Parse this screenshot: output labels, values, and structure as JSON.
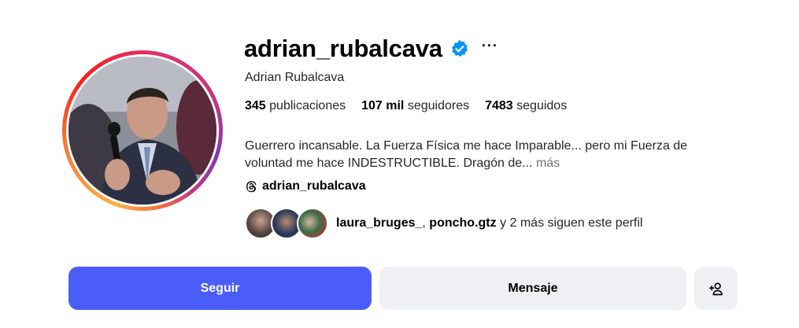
{
  "profile": {
    "username": "adrian_rubalcava",
    "full_name": "Adrian Rubalcava",
    "stats": {
      "posts_count": "345",
      "posts_label": "publicaciones",
      "followers_count": "107 mil",
      "followers_label": "seguidores",
      "following_count": "7483",
      "following_label": "seguidos"
    },
    "bio": "Guerrero incansable. La Fuerza Física me hace Imparable... pero mi Fuerza de voluntad me hace INDESTRUCTIBLE. Dragón de...",
    "bio_more": "más",
    "threads_handle": "adrian_rubalcava",
    "followed_by": {
      "user1": "laura_bruges_",
      "separator": ",",
      "user2": "poncho.gtz",
      "suffix": "y 2 más siguen este perfil"
    }
  },
  "actions": {
    "follow_label": "Seguir",
    "message_label": "Mensaje"
  },
  "icons": {
    "verified": "verified-badge-icon",
    "more": "more-options-icon",
    "threads": "threads-icon",
    "add_user": "add-user-icon"
  },
  "colors": {
    "follow_button": "#4a5df9",
    "secondary_button": "#eff0f3",
    "verified": "#0095f6"
  }
}
